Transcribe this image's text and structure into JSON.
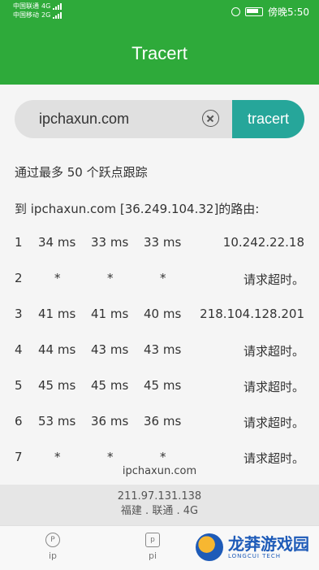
{
  "status_bar": {
    "carrier1": "中国联通",
    "carrier2": "中国移动",
    "net1": "4G",
    "net2": "2G",
    "time": "傍晚5:50"
  },
  "app": {
    "title": "Tracert"
  },
  "search": {
    "value": "ipchaxun.com",
    "button_label": "tracert"
  },
  "result": {
    "header_line": "通过最多 50 个跃点跟踪",
    "route_line": "到  ipchaxun.com  [36.249.104.32]的路由:",
    "hops": [
      {
        "num": "1",
        "t1": "34 ms",
        "t2": "33 ms",
        "t3": "33 ms",
        "addr": "10.242.22.18"
      },
      {
        "num": "2",
        "t1": "*",
        "t2": "*",
        "t3": "*",
        "addr": "请求超时。"
      },
      {
        "num": "3",
        "t1": "41 ms",
        "t2": "41 ms",
        "t3": "40 ms",
        "addr": "218.104.128.201"
      },
      {
        "num": "4",
        "t1": "44 ms",
        "t2": "43 ms",
        "t3": "43 ms",
        "addr": "请求超时。"
      },
      {
        "num": "5",
        "t1": "45 ms",
        "t2": "45 ms",
        "t3": "45 ms",
        "addr": "请求超时。"
      },
      {
        "num": "6",
        "t1": "53 ms",
        "t2": "36 ms",
        "t3": "36 ms",
        "addr": "请求超时。"
      },
      {
        "num": "7",
        "t1": "*",
        "t2": "*",
        "t3": "*",
        "addr": "请求超时。"
      }
    ]
  },
  "footer": {
    "domain": "ipchaxun.com",
    "ip": "211.97.131.138",
    "location": "福建 . 联通 . 4G"
  },
  "bottom_nav": {
    "items": [
      {
        "label": "ip",
        "icon": "ip-icon"
      },
      {
        "label": "pi",
        "icon": "ping-icon"
      }
    ]
  },
  "watermark": {
    "text": "龙莽游戏园",
    "sub": "LONGCUI TECH"
  },
  "colors": {
    "primary": "#2eaa3a",
    "button": "#26a69a"
  }
}
